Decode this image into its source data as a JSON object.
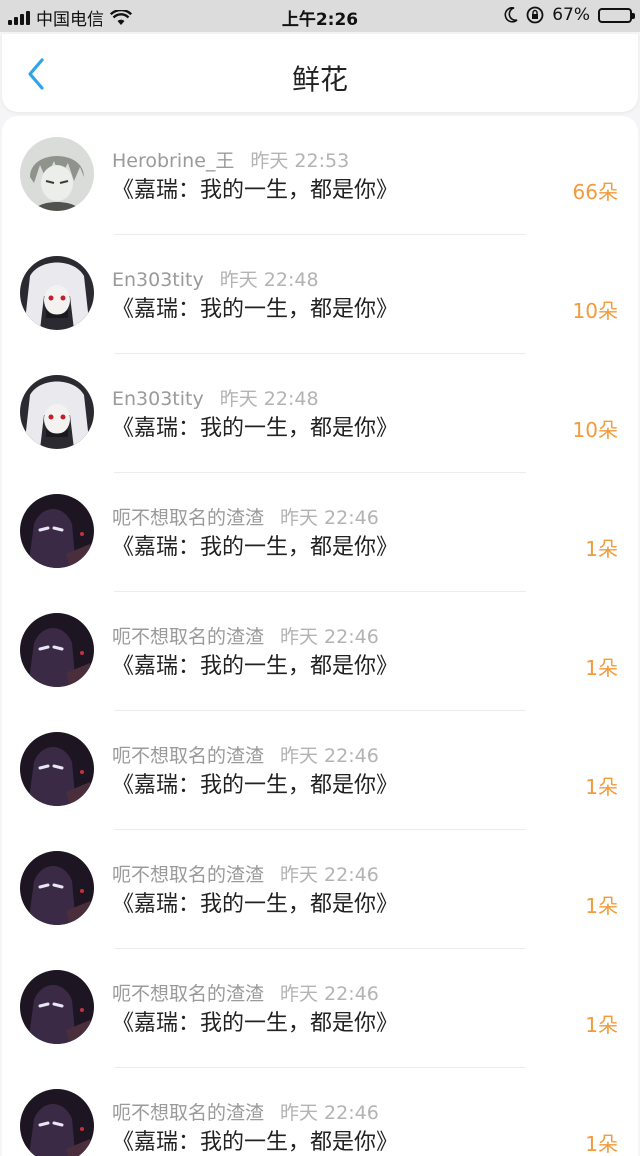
{
  "status_bar": {
    "carrier": "中国电信",
    "time": "上午2:26",
    "battery_percent": "67%",
    "battery_level": 0.67,
    "icons": [
      "signal-icon",
      "wifi-icon",
      "moon-icon",
      "rotation-lock-icon",
      "battery-icon"
    ]
  },
  "header": {
    "title": "鲜花",
    "back_icon": "chevron-left-icon",
    "accent_color": "#2fa4e7"
  },
  "colors": {
    "count": "#f39a3a",
    "meta": "#9a9a9a"
  },
  "items": [
    {
      "name": "Herobrine_王",
      "time": "昨天 22:53",
      "gift": "《嘉瑞：我的一生，都是你》",
      "count": "66朵",
      "avatar": "gray-anime"
    },
    {
      "name": "En303tity",
      "time": "昨天 22:48",
      "gift": "《嘉瑞：我的一生，都是你》",
      "count": "10朵",
      "avatar": "white-hair"
    },
    {
      "name": "En303tity",
      "time": "昨天 22:48",
      "gift": "《嘉瑞：我的一生，都是你》",
      "count": "10朵",
      "avatar": "white-hair"
    },
    {
      "name": "呃不想取名的渣渣",
      "time": "昨天 22:46",
      "gift": "《嘉瑞：我的一生，都是你》",
      "count": "1朵",
      "avatar": "dark-purple"
    },
    {
      "name": "呃不想取名的渣渣",
      "time": "昨天 22:46",
      "gift": "《嘉瑞：我的一生，都是你》",
      "count": "1朵",
      "avatar": "dark-purple"
    },
    {
      "name": "呃不想取名的渣渣",
      "time": "昨天 22:46",
      "gift": "《嘉瑞：我的一生，都是你》",
      "count": "1朵",
      "avatar": "dark-purple"
    },
    {
      "name": "呃不想取名的渣渣",
      "time": "昨天 22:46",
      "gift": "《嘉瑞：我的一生，都是你》",
      "count": "1朵",
      "avatar": "dark-purple"
    },
    {
      "name": "呃不想取名的渣渣",
      "time": "昨天 22:46",
      "gift": "《嘉瑞：我的一生，都是你》",
      "count": "1朵",
      "avatar": "dark-purple"
    },
    {
      "name": "呃不想取名的渣渣",
      "time": "昨天 22:46",
      "gift": "《嘉瑞：我的一生，都是你》",
      "count": "1朵",
      "avatar": "dark-purple"
    }
  ]
}
